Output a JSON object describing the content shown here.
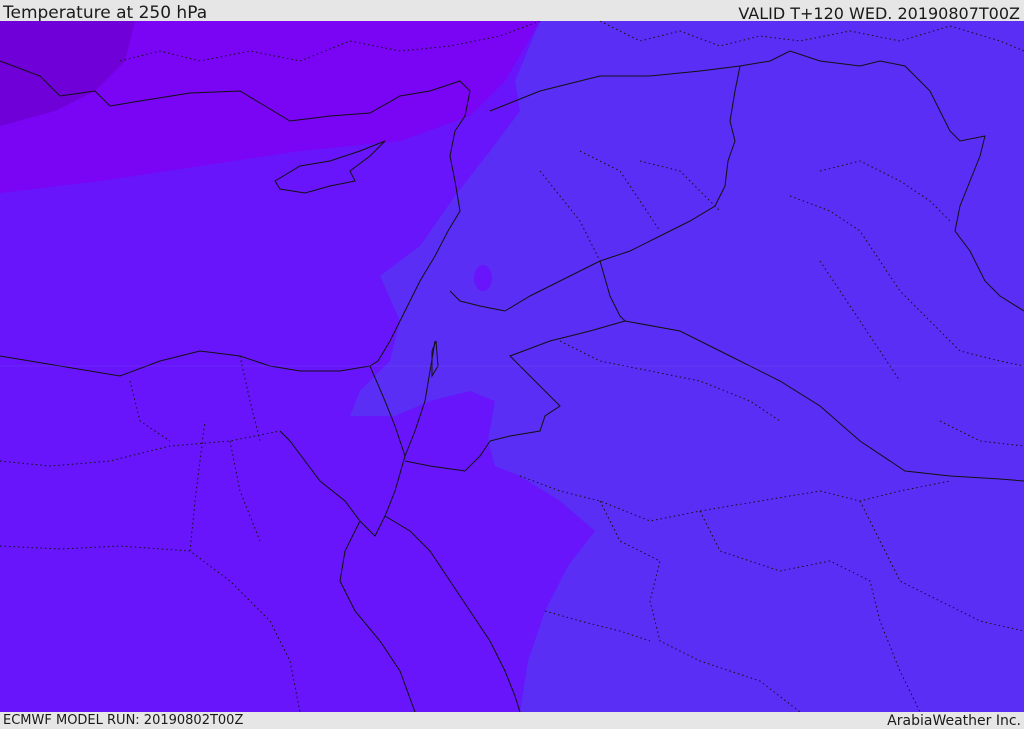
{
  "header": {
    "title": "Temperature at 250 hPa",
    "valid": "VALID T+120 WED. 20190807T00Z"
  },
  "footer": {
    "model_run": "ECMWF MODEL RUN: 20190802T00Z",
    "credit": "ArabiaWeather Inc."
  },
  "colors": {
    "warm_band": "#5a2ef5",
    "mid_band": "#6815fb",
    "cold_band": "#7a04f4",
    "coldest_band": "#7000d8",
    "border_line": "#111111"
  }
}
